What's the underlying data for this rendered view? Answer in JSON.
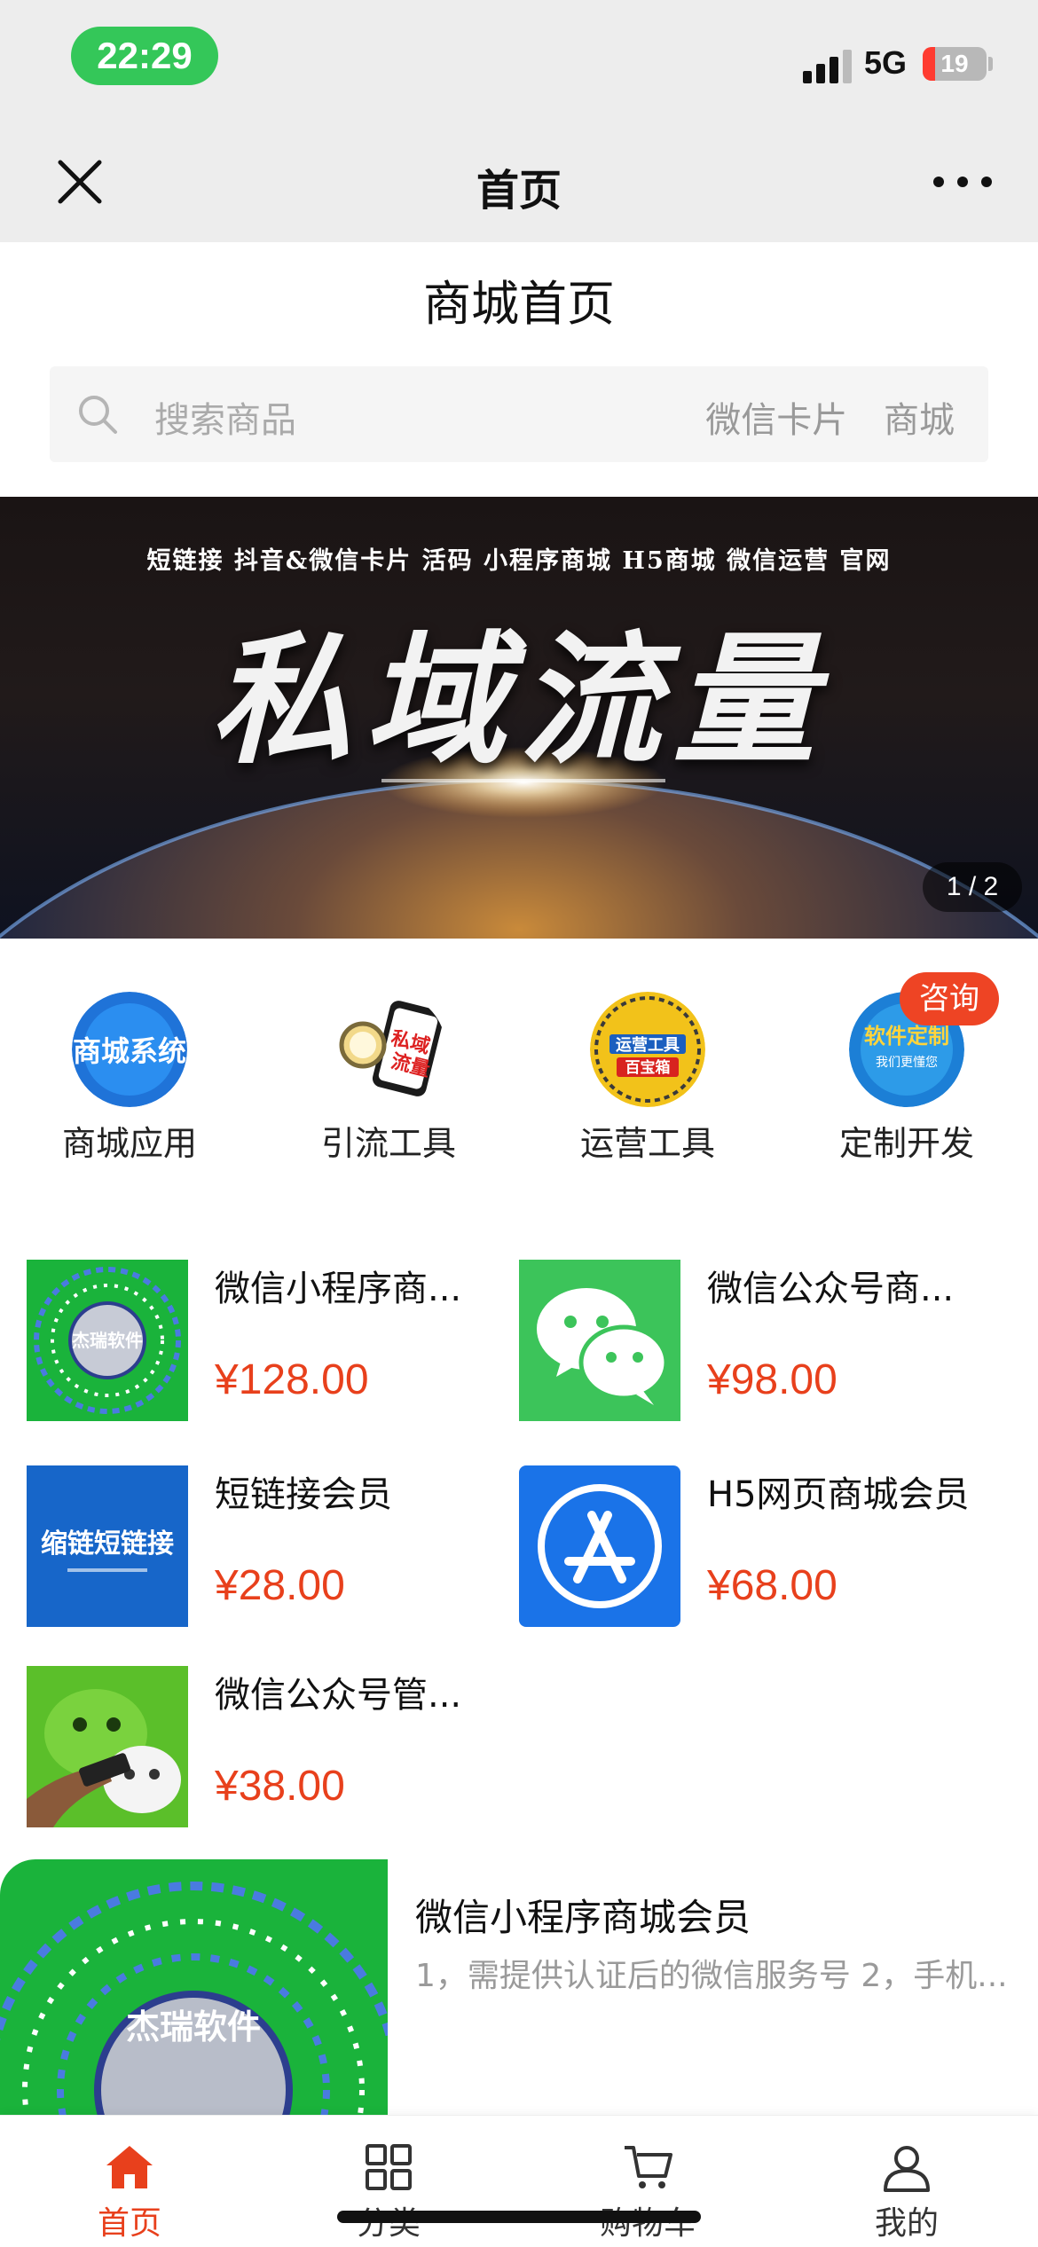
{
  "status_bar": {
    "time": "22:29",
    "network": "5G",
    "battery": "19",
    "battery_level": 0.19
  },
  "nav": {
    "title": "首页"
  },
  "page": {
    "title": "商城首页"
  },
  "search": {
    "placeholder": "搜索商品",
    "hot": [
      "微信卡片",
      "商城"
    ]
  },
  "banner": {
    "top_line": "短链接 抖音&微信卡片 活码 小程序商城 H5商城 微信运营 官网",
    "headline": "私域流量",
    "indicator": "1 / 2"
  },
  "categories": [
    {
      "label": "商城应用",
      "icon_text": "商城系统"
    },
    {
      "label": "引流工具",
      "icon_text": "私域流量"
    },
    {
      "label": "运营工具",
      "icon_text": "运营工具百宝箱"
    },
    {
      "label": "定制开发",
      "icon_text": "软件定制",
      "badge": "咨询"
    }
  ],
  "products": [
    {
      "name": "微信小程序商...",
      "price": "¥128.00",
      "thumb_text": "杰瑞软件"
    },
    {
      "name": "微信公众号商...",
      "price": "¥98.00"
    },
    {
      "name": "短链接会员",
      "price": "¥28.00",
      "thumb_text": "缩链短链接"
    },
    {
      "name": "H5网页商城会员",
      "price": "¥68.00"
    },
    {
      "name": "微信公众号管...",
      "price": "¥38.00"
    }
  ],
  "list_item": {
    "name": "微信小程序商城会员",
    "description": "1，需提供认证后的微信服务号 2，手机...",
    "thumb_text": "杰瑞软件"
  },
  "tabbar": [
    {
      "label": "首页",
      "icon": "home-icon",
      "active": true
    },
    {
      "label": "分类",
      "icon": "grid-icon"
    },
    {
      "label": "购物车",
      "icon": "cart-icon"
    },
    {
      "label": "我的",
      "icon": "user-icon"
    }
  ],
  "colors": {
    "accent": "#e8401c",
    "status_green": "#34c759",
    "nav_bg": "#ededed"
  }
}
